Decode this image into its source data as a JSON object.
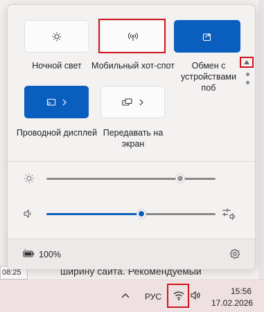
{
  "background": {
    "cell_text": "08:25",
    "body_text": "ширину сайта. Рекомендуемый"
  },
  "quick_settings": {
    "tiles": [
      {
        "id": "night-light",
        "label": "Ночной свет",
        "icon": "brightness-icon",
        "active": false,
        "has_chevron": false
      },
      {
        "id": "mobile-hotspot",
        "label": "Мобильный хот-спот",
        "icon": "hotspot-icon",
        "active": false,
        "has_chevron": false
      },
      {
        "id": "nearby-share",
        "label": "Обмен с устройствами поб",
        "icon": "share-icon",
        "active": true,
        "has_chevron": false
      },
      {
        "id": "wired-display",
        "label": "Проводной дисплей",
        "icon": "cast-icon",
        "active": true,
        "has_chevron": true
      },
      {
        "id": "project",
        "label": "Передавать на экран",
        "icon": "project-icon",
        "active": false,
        "has_chevron": true
      }
    ],
    "brightness": {
      "icon": "brightness-icon",
      "level": 0.79
    },
    "volume": {
      "icon": "speaker-icon",
      "level": 0.56,
      "mixer_icon": "audio-mixer-icon"
    },
    "battery": {
      "icon": "battery-icon",
      "percent": "100%"
    },
    "settings_icon": "gear-icon"
  },
  "taskbar": {
    "language": "РУС",
    "time": "15:56",
    "date": "17.02.2026",
    "icons": [
      "chevron-up-icon",
      "wifi-icon",
      "speaker-icon"
    ]
  },
  "colors": {
    "accent": "#0a5ebd",
    "highlight": "#d0121e"
  }
}
